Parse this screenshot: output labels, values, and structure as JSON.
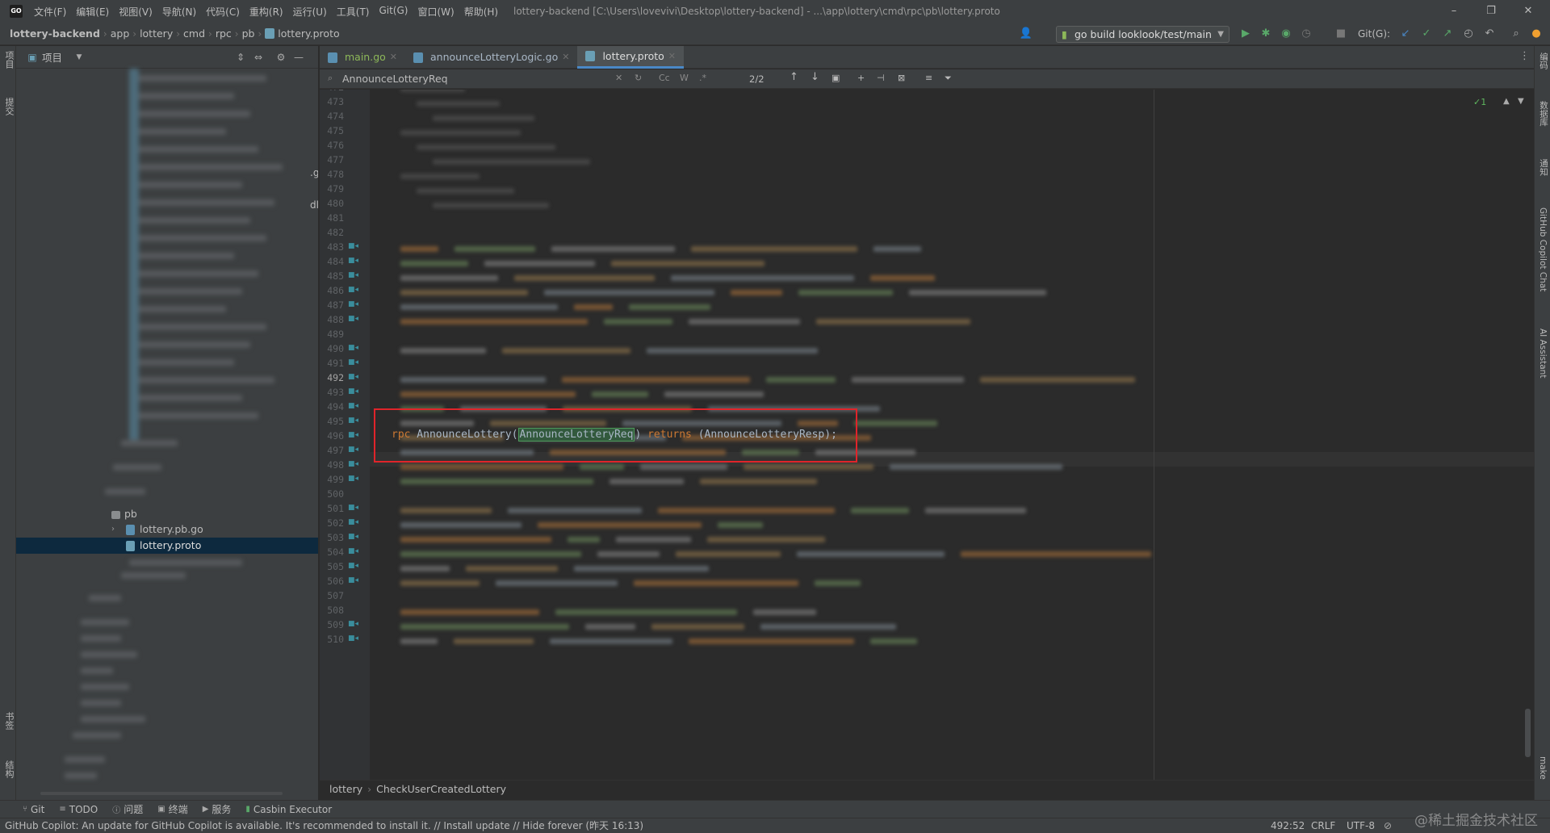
{
  "title_bar": {
    "logo": "GO",
    "menus": [
      "文件(F)",
      "编辑(E)",
      "视图(V)",
      "导航(N)",
      "代码(C)",
      "重构(R)",
      "运行(U)",
      "工具(T)",
      "Git(G)",
      "窗口(W)",
      "帮助(H)"
    ],
    "window_title": "lottery-backend [C:\\Users\\lovevivi\\Desktop\\lottery-backend] - ...\\app\\lottery\\cmd\\rpc\\pb\\lottery.proto",
    "controls": [
      "–",
      "❐",
      "✕"
    ]
  },
  "navbar": {
    "breadcrumbs": [
      "lottery-backend",
      "app",
      "lottery",
      "cmd",
      "rpc",
      "pb",
      "lottery.proto"
    ],
    "run_config": "go build looklook/test/main",
    "git_label": "Git(G):"
  },
  "left_strip": {
    "labels": [
      "项目",
      "提交",
      "书签",
      "结构"
    ]
  },
  "right_strip": {
    "labels": [
      "编码",
      "数据库",
      "通知",
      "GitHub Copilot Chat",
      "AI Assistant",
      "make"
    ]
  },
  "project_panel": {
    "title": "项目",
    "tree": [
      {
        "label": "pb",
        "kind": "folder"
      },
      {
        "label": "lottery.pb.go",
        "kind": "go-file"
      },
      {
        "label": "lottery.proto",
        "kind": "proto-file",
        "selected": true
      }
    ],
    "clipped_suffixes": [
      ".g",
      "dl"
    ]
  },
  "tabs": [
    {
      "label": "main.go",
      "active": false
    },
    {
      "label": "announceLotteryLogic.go",
      "active": false
    },
    {
      "label": "lottery.proto",
      "active": true
    }
  ],
  "search": {
    "query": "AnnounceLotteryReq",
    "match_count": "2/2",
    "options": [
      "Cc",
      "W",
      ".*"
    ]
  },
  "editor": {
    "line_numbers": [
      "472",
      "473",
      "474",
      "475",
      "476",
      "477",
      "478",
      "479",
      "480",
      "481",
      "482",
      "483",
      "484",
      "485",
      "486",
      "487",
      "488",
      "489",
      "490",
      "491",
      "492",
      "493",
      "494",
      "495",
      "496",
      "497",
      "498",
      "499",
      "500",
      "501",
      "502",
      "503",
      "504",
      "505",
      "506",
      "507",
      "508",
      "509",
      "510"
    ],
    "current_line": "492",
    "visible_code": {
      "keyword_rpc": "rpc",
      "method": " AnnounceLottery(",
      "highlighted_param": "AnnounceLotteryReq",
      "close_paren": ") ",
      "keyword_returns": "returns",
      "return_type": " (AnnounceLotteryResp);"
    },
    "inspection": "✓1"
  },
  "editor_breadcrumb": [
    "lottery",
    "CheckUserCreatedLottery"
  ],
  "tool_windows": [
    "Git",
    "TODO",
    "问题",
    "终端",
    "服务",
    "Casbin Executor"
  ],
  "status": {
    "message": "GitHub Copilot: An update for GitHub Copilot is available. It's recommended to install it. // Install update // Hide forever (昨天 16:13)",
    "position": "492:52",
    "line_sep": "CRLF",
    "encoding": "UTF-8"
  },
  "watermark": "@稀土掘金技术社区",
  "colors": {
    "accent": "#4a88c7",
    "keyword": "#cc7832",
    "annotation_box": "#e0242a",
    "match_highlight": "#32593d"
  }
}
